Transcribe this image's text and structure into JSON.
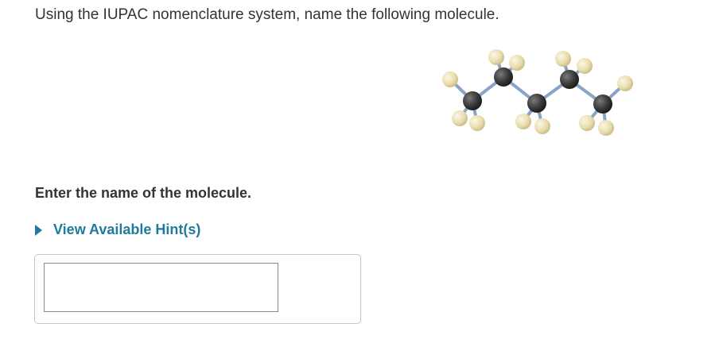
{
  "question": {
    "text": "Using the IUPAC nomenclature system, name the following molecule."
  },
  "molecule": {
    "icon": "ball-and-stick-molecule-icon",
    "carbon_color": "#3d3d3d",
    "hydrogen_color": "#ede3b6",
    "bond_color": "#8aa3c6"
  },
  "answer": {
    "prompt": "Enter the name of the molecule.",
    "hint_label": "View Available Hint(s)",
    "value": "",
    "placeholder": ""
  },
  "colors": {
    "link": "#1f7a9e",
    "text": "#333333",
    "panel_border": "#c7c7c7"
  }
}
